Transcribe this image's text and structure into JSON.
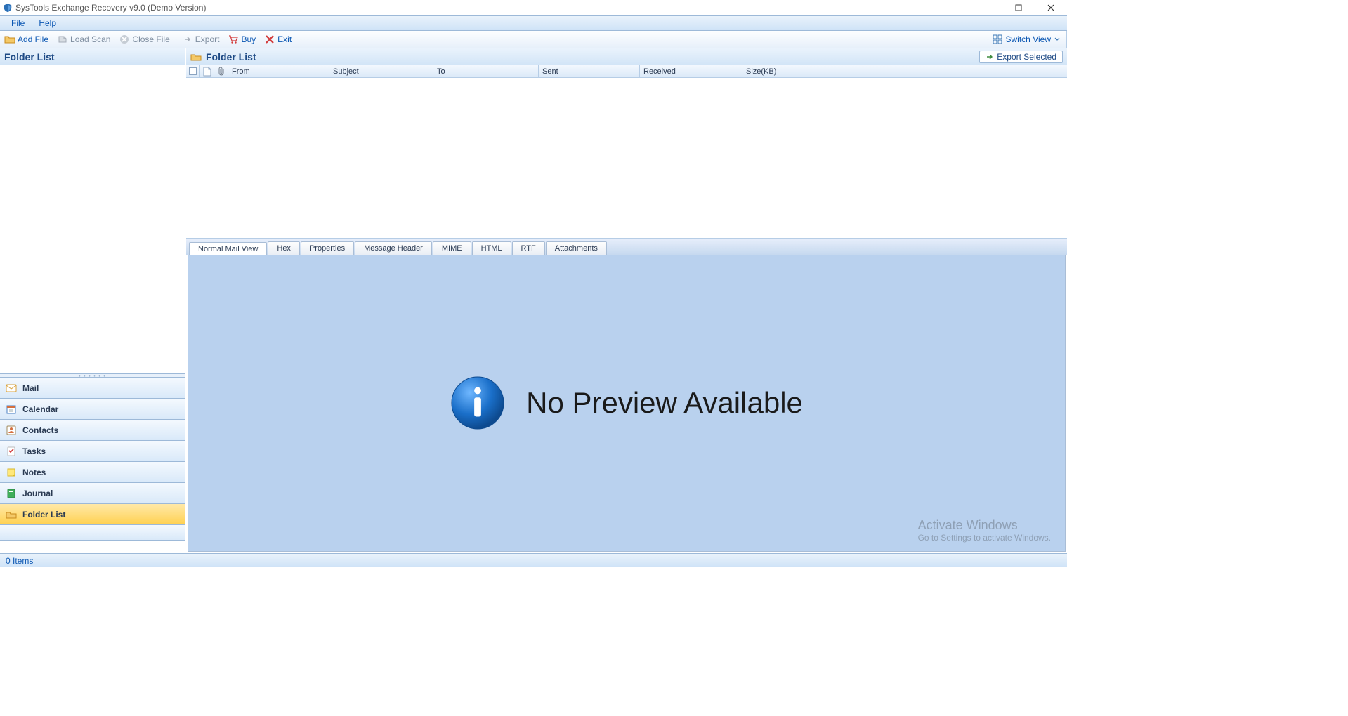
{
  "title": "SysTools Exchange Recovery v9.0 (Demo Version)",
  "menubar": {
    "file": "File",
    "help": "Help"
  },
  "toolbar": {
    "add_file": "Add File",
    "load_scan": "Load Scan",
    "close_file": "Close File",
    "export": "Export",
    "buy": "Buy",
    "exit": "Exit",
    "switch_view": "Switch View"
  },
  "left": {
    "header": "Folder List",
    "nav": {
      "mail": "Mail",
      "calendar": "Calendar",
      "contacts": "Contacts",
      "tasks": "Tasks",
      "notes": "Notes",
      "journal": "Journal",
      "folder_list": "Folder List"
    }
  },
  "right": {
    "header": "Folder List",
    "export_selected": "Export Selected",
    "columns": {
      "from": "From",
      "subject": "Subject",
      "to": "To",
      "sent": "Sent",
      "received": "Received",
      "size": "Size(KB)"
    },
    "tabs": {
      "normal": "Normal Mail View",
      "hex": "Hex",
      "properties": "Properties",
      "msg_header": "Message Header",
      "mime": "MIME",
      "html": "HTML",
      "rtf": "RTF",
      "attachments": "Attachments"
    },
    "preview": {
      "no_preview": "No Preview Available"
    }
  },
  "watermark": {
    "line1": "Activate Windows",
    "line2": "Go to Settings to activate Windows."
  },
  "statusbar": {
    "items": "0 Items"
  }
}
